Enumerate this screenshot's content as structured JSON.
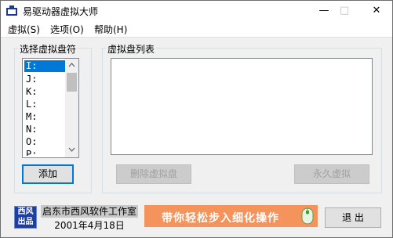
{
  "window": {
    "title": "易驱动器虚拟大师"
  },
  "titlebar": {
    "minimize": "—",
    "maximize": "□",
    "close": "✕"
  },
  "menu": {
    "items": [
      "虚拟(S)",
      "选项(O)",
      "帮助(H)"
    ]
  },
  "left_group": {
    "label": "选择虚拟盘符",
    "drives": [
      "I:",
      "J:",
      "K:",
      "L:",
      "M:",
      "N:",
      "O:",
      "P:"
    ],
    "selected": "I:",
    "add_button": "添加"
  },
  "right_group": {
    "label": "虚拟盘列表",
    "delete_button": "删除虚拟盘",
    "permanent_button": "永久虚拟"
  },
  "footer": {
    "logo_top": "西风",
    "logo_bottom": "出品",
    "company": "启东市西风软件工作室",
    "date": "2001年4月18日",
    "banner": "带你轻松步入细化操作",
    "exit_button": "退 出"
  }
}
